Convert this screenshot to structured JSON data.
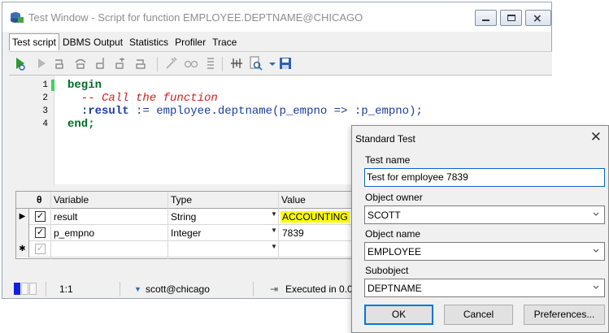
{
  "window": {
    "title": "Test Window - Script for function EMPLOYEE.DEPTNAME@CHICAGO",
    "tabs": [
      {
        "label": "Test script",
        "active": true
      },
      {
        "label": "DBMS Output",
        "active": false
      },
      {
        "label": "Statistics",
        "active": false
      },
      {
        "label": "Profiler",
        "active": false
      },
      {
        "label": "Trace",
        "active": false
      }
    ],
    "toolbar_icons": [
      "execute-icon",
      "run-icon",
      "step-into-icon",
      "step-over-icon",
      "step-out-icon",
      "run-to-exception-icon",
      "stop-icon",
      "toggle-breakpoint-icon",
      "watch-icon",
      "list-icon",
      "plan-icon",
      "search-icon",
      "save-icon"
    ]
  },
  "editor": {
    "line_numbers": [
      "1",
      "2",
      "3",
      "4"
    ],
    "lines": [
      {
        "kw": "begin"
      },
      {
        "comment": "  -- Call the function"
      },
      {
        "indent": "  ",
        "bind1": ":result",
        "op": " := ",
        "call": "employee.deptname(p_empno => ",
        "bind2": ":p_empno",
        "tail": ");"
      },
      {
        "kw": "end;"
      }
    ]
  },
  "grid": {
    "headers": {
      "flag": "θ",
      "variable": "Variable",
      "type": "Type",
      "value": "Value"
    },
    "rows": [
      {
        "indicator": "▶",
        "checked": "✓",
        "variable": "result",
        "type": "String",
        "value": "ACCOUNTING",
        "highlight": true
      },
      {
        "indicator": "",
        "checked": "✓",
        "variable": "p_empno",
        "type": "Integer",
        "value": "7839",
        "highlight": false
      },
      {
        "indicator": "✱",
        "checked": "✓",
        "variable": "",
        "type": "",
        "value": "",
        "highlight": false
      }
    ]
  },
  "status": {
    "position": "1:1",
    "connection": "scott@chicago",
    "message": "Executed in 0.0"
  },
  "dialog": {
    "title": "Standard Test",
    "close": "✕",
    "test_name_label": "Test name",
    "test_name_value": "Test for employee 7839",
    "owner_label": "Object owner",
    "owner_value": "SCOTT",
    "object_name_label": "Object name",
    "object_name_value": "EMPLOYEE",
    "subobject_label": "Subobject",
    "subobject_value": "DEPTNAME",
    "ok": "OK",
    "cancel": "Cancel",
    "preferences": "Preferences..."
  },
  "colors": {
    "keyword": "#006b24",
    "comment": "#d42020",
    "identifier": "#1a3d9c",
    "value_highlight": "#ffff00",
    "status_blue": "#1020e0",
    "dialog_accent": "#0078d7"
  }
}
